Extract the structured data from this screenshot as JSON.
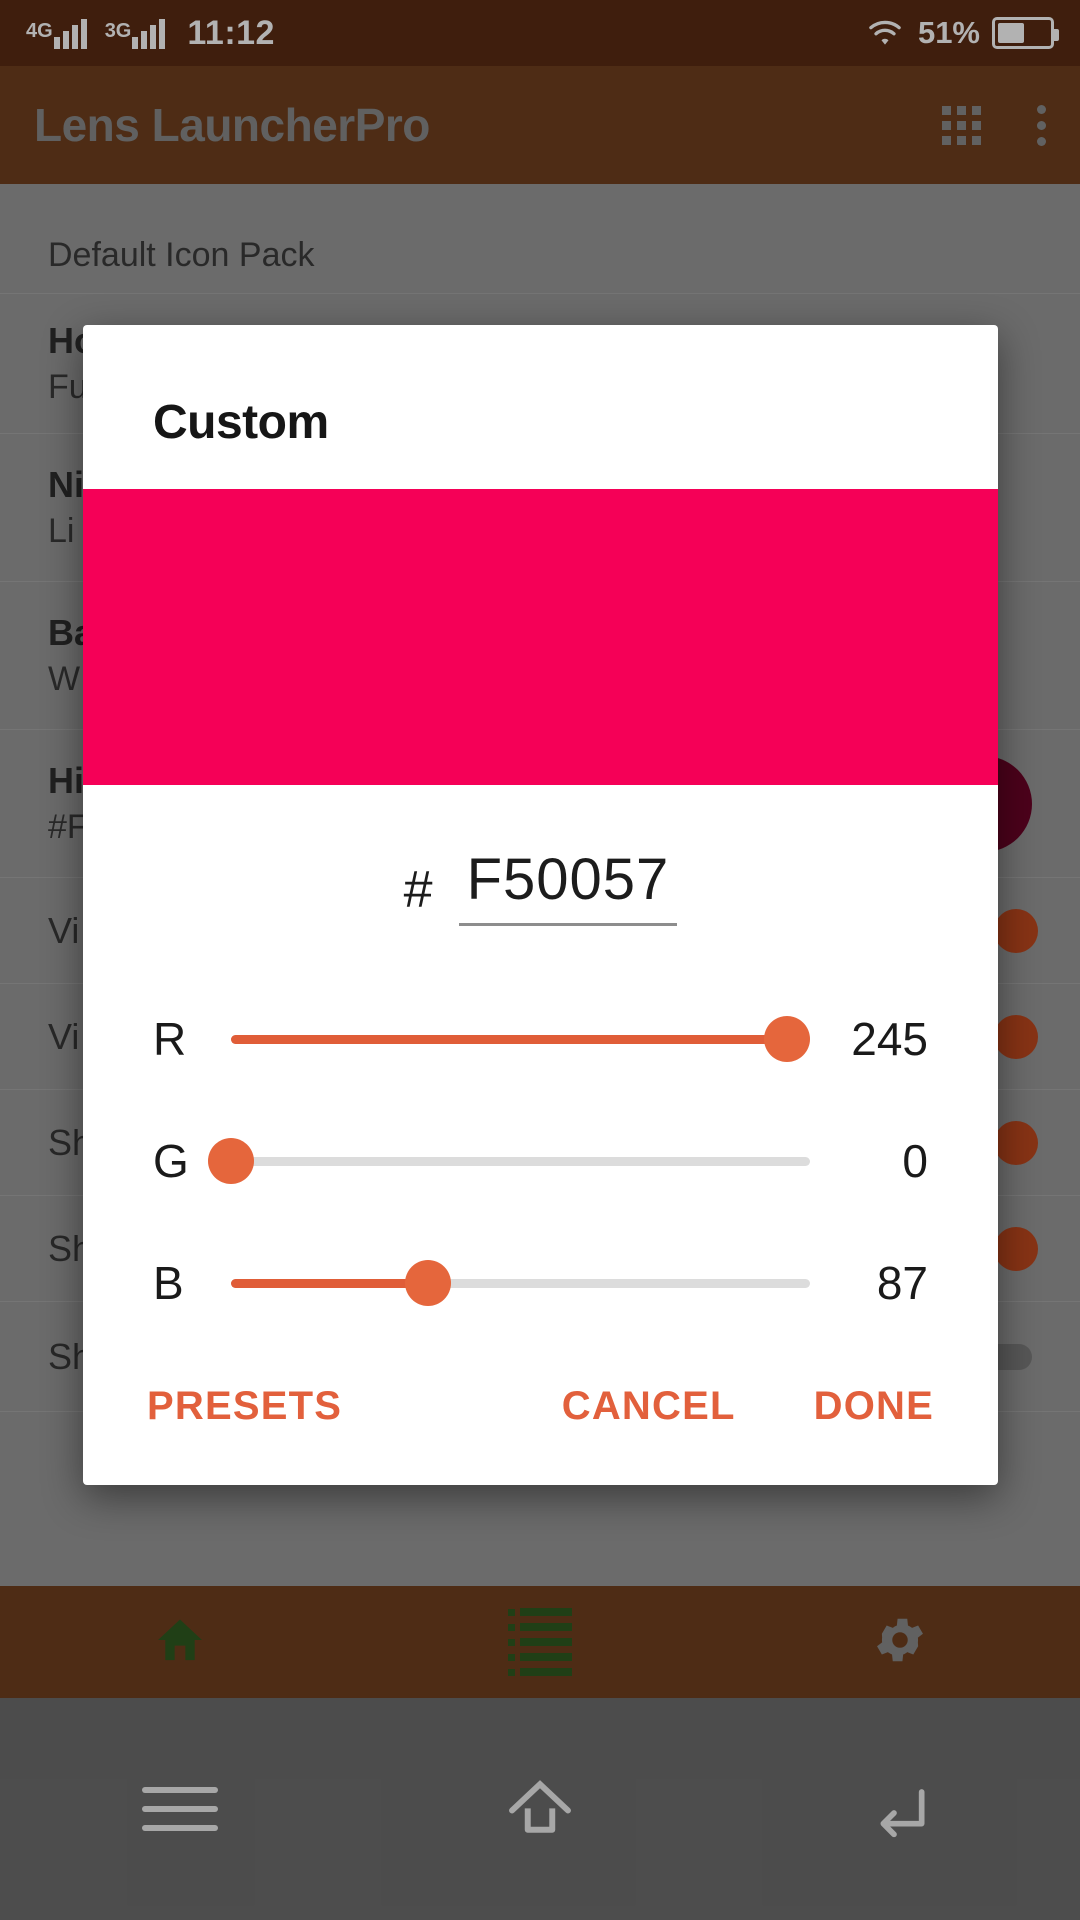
{
  "status_bar": {
    "sim1_network": "4G",
    "sim2_network": "3G",
    "time": "11:12",
    "battery_percent": "51%",
    "wifi_icon": "wifi-icon",
    "battery_icon": "battery-icon"
  },
  "app_bar": {
    "title": "Lens LauncherPro",
    "apps_grid_icon": "apps-grid-icon",
    "overflow_icon": "overflow-menu-icon"
  },
  "settings_list": [
    {
      "title": "",
      "subtitle": "Default Icon Pack",
      "control": "none"
    },
    {
      "title": "Home Launcher",
      "subtitle": "Fu",
      "control": "none"
    },
    {
      "title": "Night Mode",
      "subtitle": "Li",
      "control": "none"
    },
    {
      "title": "Background",
      "subtitle": "W",
      "control": "none"
    },
    {
      "title": "Highlight Color",
      "subtitle": "#F",
      "control": "color-dot",
      "color": "#6D0427"
    },
    {
      "title": "Vi",
      "subtitle": "",
      "control": "switch",
      "switch_state": "on"
    },
    {
      "title": "Vi",
      "subtitle": "",
      "control": "switch",
      "switch_state": "on"
    },
    {
      "title": "Sh",
      "subtitle": "",
      "control": "switch",
      "switch_state": "on"
    },
    {
      "title": "Show New App Tag",
      "subtitle": "",
      "control": "switch",
      "switch_state": "on"
    },
    {
      "title": "Show Touch Selection",
      "subtitle": "",
      "control": "switch",
      "switch_state": "off"
    }
  ],
  "tab_bar": {
    "tabs": [
      {
        "name": "home",
        "icon": "home-icon",
        "color": "#2E5B20"
      },
      {
        "name": "apps-list",
        "icon": "list-icon",
        "color": "#2E5B20"
      },
      {
        "name": "settings",
        "icon": "gear-icon",
        "color": "#8C8C8C"
      }
    ]
  },
  "nav_bar": {
    "menu_icon": "menu-icon",
    "home_icon": "home-outline-icon",
    "back_icon": "back-icon"
  },
  "dialog": {
    "title": "Custom",
    "preview_color": "#F50057",
    "hex_prefix": "#",
    "hex_value": "F50057",
    "accent_color": "#E2603C",
    "channels": [
      {
        "label": "R",
        "value": "245",
        "percent": 96
      },
      {
        "label": "G",
        "value": "0",
        "percent": 0
      },
      {
        "label": "B",
        "value": "87",
        "percent": 34
      }
    ],
    "buttons": {
      "presets": "PRESETS",
      "cancel": "CANCEL",
      "done": "DONE"
    }
  }
}
